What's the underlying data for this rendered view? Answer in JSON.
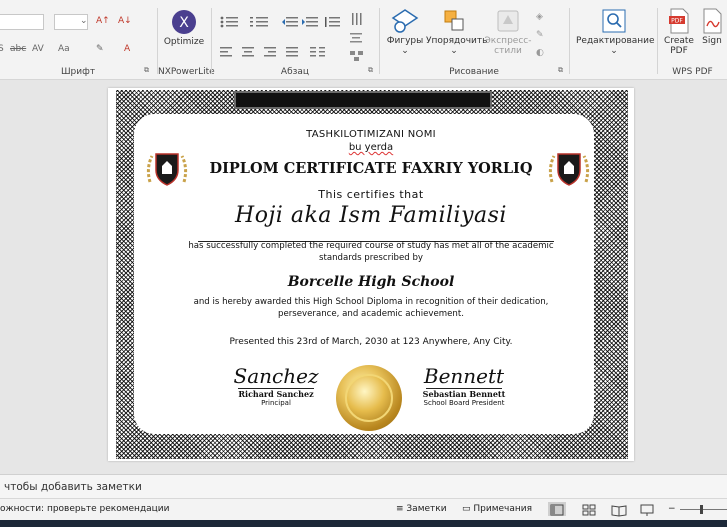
{
  "ribbon": {
    "font_group_label": "Шрифт",
    "nxpowerlite_label": "NXPowerLite",
    "optimize_label": "Optimize",
    "paragraph_label": "Абзац",
    "drawing_label": "Рисование",
    "shapes_label": "Фигуры",
    "arrange_label": "Упорядочить",
    "express_styles_label": "Экспресс-стили",
    "editing_label": "Редактирование",
    "wps_pdf_label": "WPS PDF",
    "create_pdf_label": "Create PDF",
    "sign_label": "Sign"
  },
  "certificate": {
    "org": "TASHKILOTIMIZANI NOMI",
    "sub": "bu yerda",
    "title": "DIPLOM CERTIFICATE FAXRIY YORLIQ",
    "certifies": "This certifies that",
    "recipient": "Hoji aka Ism Familiyasi",
    "body1": "has successfully completed the required course of study has met all of the academic standards prescribed by",
    "school": "Borcelle High School",
    "body2": "and is hereby awarded this High School Diploma in recognition of their dedication, perseverance, and academic achievement.",
    "presented": "Presented this 23rd of March, 2030 at  123 Anywhere, Any City.",
    "signer1_script": "Sanchez",
    "signer1_name": "Richard Sanchez",
    "signer1_role": "Principal",
    "signer2_script": "Bennett",
    "signer2_name": "Sebastian Bennett",
    "signer2_role": "School Board President"
  },
  "notes": {
    "placeholder": "чтобы добавить заметки"
  },
  "status": {
    "accessibility": "ожности: проверьте рекомендации",
    "notes_button": "Заметки",
    "comments_button": "Примечания"
  },
  "colors": {
    "ribbon_bg": "#f3f3f3",
    "accent_red": "#c0392b",
    "seal_gold": "#d4a83a",
    "optimize_purple": "#4a3f8f"
  }
}
